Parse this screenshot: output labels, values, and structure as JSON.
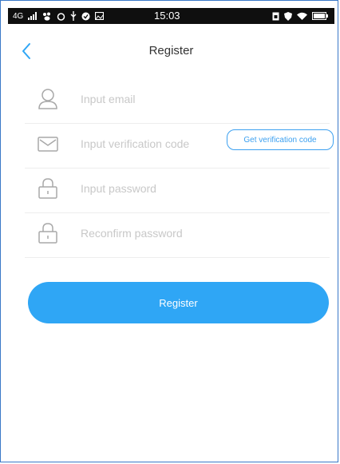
{
  "status_bar": {
    "network": "4G",
    "time": "15:03"
  },
  "header": {
    "title": "Register"
  },
  "form": {
    "email_placeholder": "Input email",
    "code_placeholder": "Input verification code",
    "get_code_label": "Get verification code",
    "password_placeholder": "Input password",
    "reconfirm_placeholder": "Reconfirm password",
    "register_label": "Register"
  },
  "colors": {
    "accent": "#2fa6f5",
    "icon_gray": "#a8a8a8",
    "placeholder": "#c8c8c8"
  },
  "icons": [
    "back-icon",
    "user-icon",
    "mail-icon",
    "lock-icon"
  ]
}
